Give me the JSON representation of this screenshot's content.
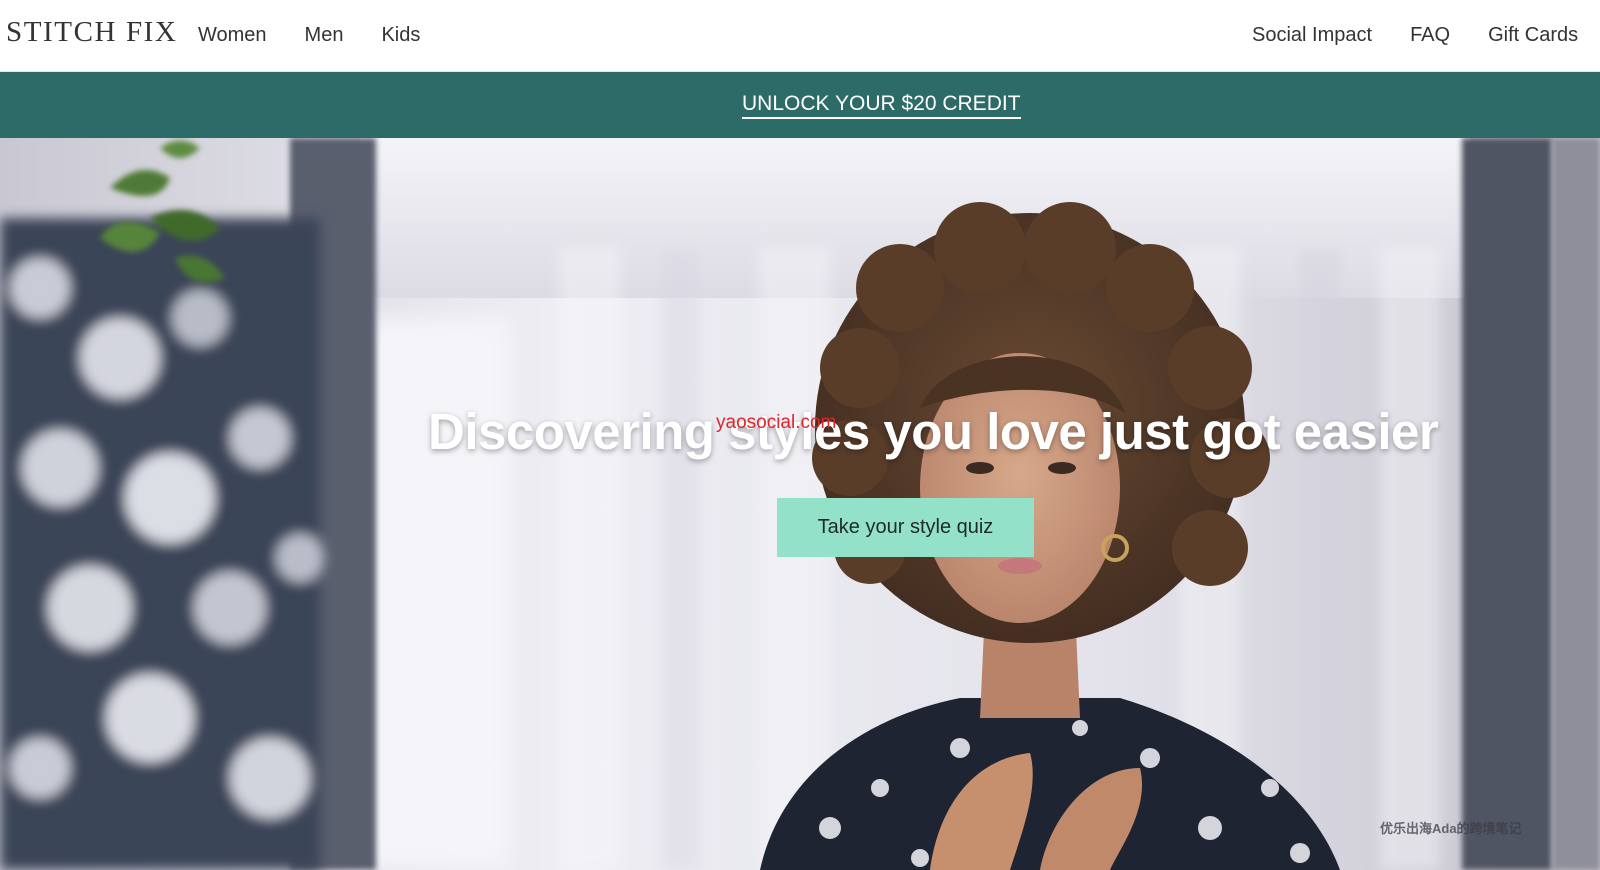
{
  "header": {
    "logo": "STITCH FIX",
    "nav_left": [
      {
        "label": "Women"
      },
      {
        "label": "Men"
      },
      {
        "label": "Kids"
      }
    ],
    "nav_right": [
      {
        "label": "Social Impact"
      },
      {
        "label": "FAQ"
      },
      {
        "label": "Gift Cards"
      }
    ]
  },
  "promo": {
    "label": "UNLOCK YOUR $20 CREDIT",
    "background": "#2d6b68"
  },
  "hero": {
    "headline": "Discovering styles you love just got easier",
    "cta_label": "Take your style quiz",
    "cta_color": "#94e1ca",
    "overlay_watermark": "yaosocial.com",
    "corner_watermark": "优乐出海Ada的跨境笔记"
  }
}
